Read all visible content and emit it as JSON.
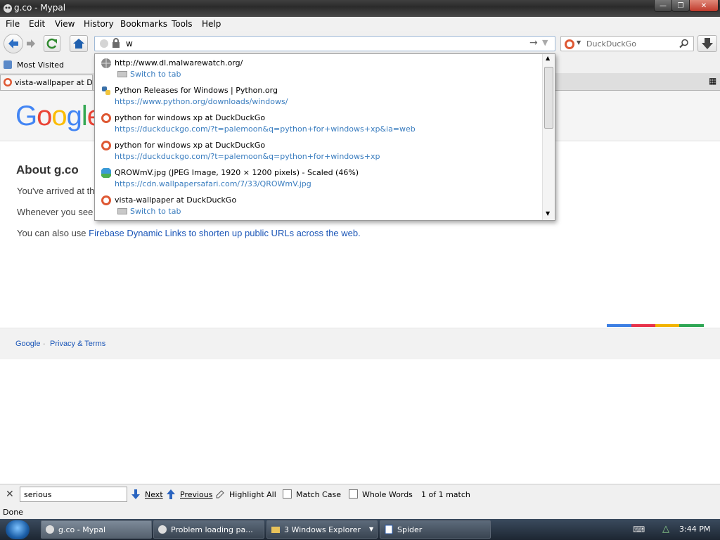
{
  "window": {
    "title": "g.co - Mypal"
  },
  "menu": {
    "items": [
      "File",
      "Edit",
      "View",
      "History",
      "Bookmarks",
      "Tools",
      "Help"
    ]
  },
  "nav": {
    "url_value": "w",
    "search_placeholder": "DuckDuckGo"
  },
  "bookmarks": {
    "most_visited": "Most Visited"
  },
  "tabs": [
    {
      "label": "vista-wallpaper at DuckDuckGo"
    }
  ],
  "page": {
    "logo": "Google",
    "about_title": "About g.co",
    "para1": "You've arrived at thi",
    "para2": "Whenever you see",
    "para3_prefix": "You can also use ",
    "para3_link": "Firebase Dynamic Links to shorten up public URLs across the web.",
    "footer_google": "Google",
    "footer_dot": "·",
    "footer_privacy": "Privacy & Terms",
    "color_bar": [
      "#3c7fe3",
      "#e8324a",
      "#f2b300",
      "#2ea654"
    ]
  },
  "autocomplete": {
    "rows": [
      {
        "title": "http://www.dl.malwarewatch.org/",
        "sub": "Switch to tab",
        "type": "switch",
        "icon": "globe-icon"
      },
      {
        "title": "Python Releases for Windows | Python.org",
        "sub": "https://www.python.org/downloads/windows/",
        "type": "url",
        "icon": "python-icon"
      },
      {
        "title": "python for windows xp at DuckDuckGo",
        "sub": "https://duckduckgo.com/?t=palemoon&q=python+for+windows+xp&ia=web",
        "type": "url",
        "icon": "duckduckgo-icon"
      },
      {
        "title": "python for windows xp at DuckDuckGo",
        "sub": "https://duckduckgo.com/?t=palemoon&q=python+for+windows+xp",
        "type": "url",
        "icon": "duckduckgo-icon"
      },
      {
        "title": "QROWmV.jpg (JPEG Image, 1920 × 1200 pixels) - Scaled (46%)",
        "sub": "https://cdn.wallpapersafari.com/7/33/QROWmV.jpg",
        "type": "url",
        "icon": "image-icon"
      },
      {
        "title": "vista-wallpaper at DuckDuckGo",
        "sub": "Switch to tab",
        "type": "switch",
        "icon": "duckduckgo-icon"
      }
    ]
  },
  "findbar": {
    "query": "serious",
    "next": "Next",
    "previous": "Previous",
    "highlight_all": "Highlight All",
    "match_case": "Match Case",
    "whole_words": "Whole Words",
    "result": "1 of 1 match"
  },
  "status": {
    "text": "Done"
  },
  "taskbar": {
    "items": [
      {
        "label": "g.co - Mypal"
      },
      {
        "label": "Problem loading pa..."
      },
      {
        "label": "3 Windows Explorer"
      },
      {
        "label": "Spider"
      }
    ],
    "clock": "3:44 PM"
  }
}
